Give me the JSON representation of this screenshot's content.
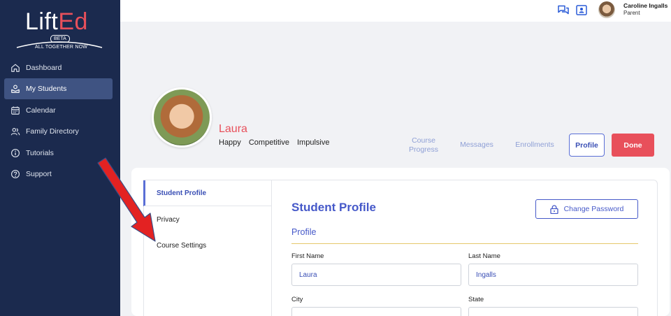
{
  "brand": {
    "logo_lift": "Lift",
    "logo_ed": "Ed",
    "beta": "BETA",
    "tagline": "ALL TOGETHER NOW"
  },
  "sidebar": {
    "items": [
      {
        "label": "Dashboard",
        "icon": "home-icon"
      },
      {
        "label": "My Students",
        "icon": "students-icon"
      },
      {
        "label": "Calendar",
        "icon": "calendar-icon"
      },
      {
        "label": "Family Directory",
        "icon": "family-icon"
      },
      {
        "label": "Tutorials",
        "icon": "info-icon"
      },
      {
        "label": "Support",
        "icon": "help-icon"
      }
    ],
    "active": "My Students"
  },
  "topbar": {
    "user_name": "Caroline Ingalls",
    "user_role": "Parent",
    "icons": [
      "chat-icon",
      "contact-card-icon"
    ]
  },
  "student": {
    "name": "Laura",
    "traits": [
      "Happy",
      "Competitive",
      "Impulsive"
    ]
  },
  "tabs": {
    "course_progress_line1": "Course",
    "course_progress_line2": "Progress",
    "messages": "Messages",
    "enrollments": "Enrollments",
    "profile": "Profile",
    "done": "Done"
  },
  "side_menu": {
    "items": [
      "Student Profile",
      "Privacy",
      "Course Settings"
    ],
    "active": "Student Profile"
  },
  "form": {
    "title": "Student Profile",
    "change_password": "Change Password",
    "section": "Profile",
    "first_name_label": "First Name",
    "first_name_value": "Laura",
    "last_name_label": "Last Name",
    "last_name_value": "Ingalls",
    "city_label": "City",
    "state_label": "State"
  },
  "colors": {
    "sidebar_bg": "#1b2a4e",
    "accent": "#4659c9",
    "brand_red": "#e8505b",
    "annotation_arrow": "#e32222"
  }
}
